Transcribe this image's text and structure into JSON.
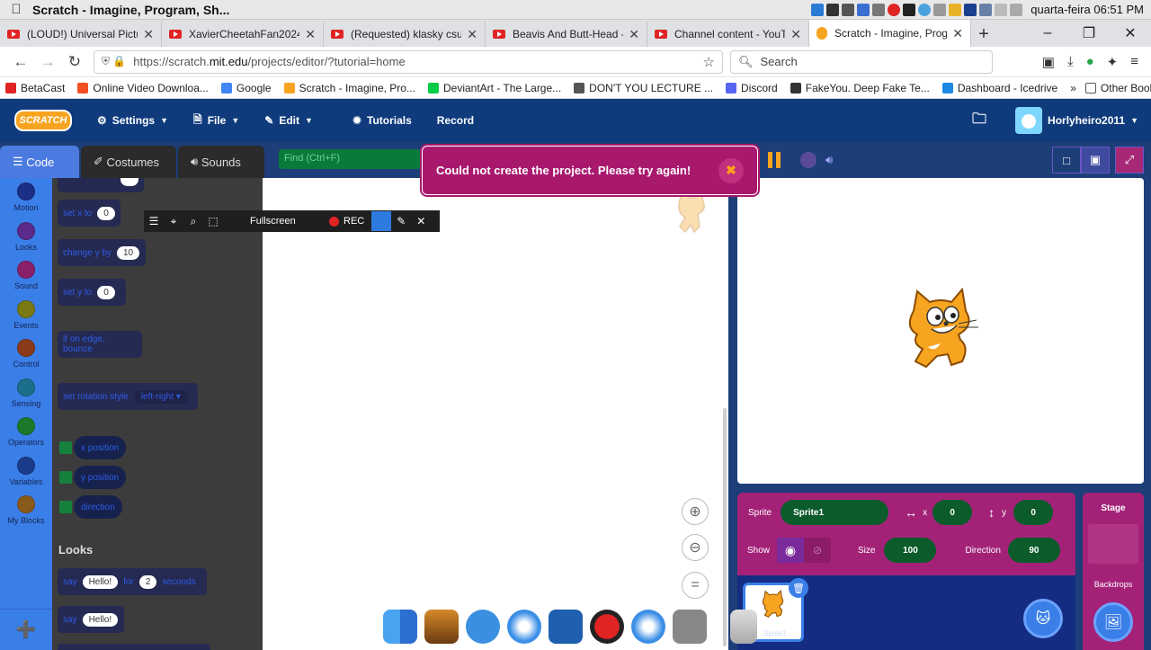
{
  "os": {
    "window_title": "Scratch - Imagine, Program, Sh...",
    "clock": "quarta-feira 06:51 PM"
  },
  "tabs": [
    {
      "label": "(LOUD!) Universal Picture",
      "icon": "youtube-icon"
    },
    {
      "label": "XavierCheetahFan2024 (F",
      "icon": "youtube-icon"
    },
    {
      "label": "(Requested) klasky csupo",
      "icon": "youtube-icon"
    },
    {
      "label": "Beavis And Butt-Head - P",
      "icon": "youtube-icon"
    },
    {
      "label": "Channel content - YouTu",
      "icon": "youtube-icon"
    },
    {
      "label": "Scratch - Imagine, Progra",
      "icon": "scratch-icon",
      "active": true
    }
  ],
  "browser": {
    "url_prefix": "https://scratch.",
    "url_host": "mit.edu",
    "url_rest": "/projects/editor/?tutorial=home",
    "search_placeholder": "Search"
  },
  "bookmarks": [
    {
      "label": "BetaCast",
      "color": "#e02424"
    },
    {
      "label": "Online Video Downloa...",
      "color": "#f25022"
    },
    {
      "label": "Google",
      "color": "#4285f4"
    },
    {
      "label": "Scratch - Imagine, Pro...",
      "color": "#f7a521"
    },
    {
      "label": "DeviantArt - The Large...",
      "color": "#05cc47"
    },
    {
      "label": "DON'T YOU LECTURE ...",
      "color": "#555555"
    },
    {
      "label": "Discord",
      "color": "#5865f2"
    },
    {
      "label": "FakeYou. Deep Fake Te...",
      "color": "#333333"
    },
    {
      "label": "Dashboard - Icedrive",
      "color": "#1e88e5"
    }
  ],
  "bookmarks_other": "Other Bookmarks",
  "scratch_menu": {
    "logo": "SCRATCH",
    "settings": "Settings",
    "file": "File",
    "edit": "Edit",
    "tutorials": "Tutorials",
    "record": "Record",
    "username": "Horlyheiro2011"
  },
  "editor_tabs": {
    "code": "Code",
    "costumes": "Costumes",
    "sounds": "Sounds"
  },
  "find_placeholder": "Find (Ctrl+F)",
  "categories": [
    {
      "label": "Motion",
      "color": "#1c2f86"
    },
    {
      "label": "Looks",
      "color": "#5b2a8a"
    },
    {
      "label": "Sound",
      "color": "#8a1f6a"
    },
    {
      "label": "Events",
      "color": "#7a7a12"
    },
    {
      "label": "Control",
      "color": "#8a3a1a"
    },
    {
      "label": "Sensing",
      "color": "#1a6f8a"
    },
    {
      "label": "Operators",
      "color": "#1a7a2a"
    },
    {
      "label": "Variables",
      "color": "#1a3c8a"
    },
    {
      "label": "My Blocks",
      "color": "#8a5a1a"
    }
  ],
  "blocks": {
    "set_x": {
      "label": "set x to",
      "value": "0"
    },
    "change_y": {
      "label": "change y by",
      "value": "10"
    },
    "set_y": {
      "label": "set y to",
      "value": "0"
    },
    "bounce": "if on edge, bounce",
    "rotation": {
      "label": "set rotation style",
      "option": "left-right"
    },
    "x_position": "x position",
    "y_position": "y position",
    "direction": "direction",
    "looks_header": "Looks",
    "say_for": {
      "say": "say",
      "text": "Hello!",
      "for": "for",
      "secs": "2",
      "seconds": "seconds"
    },
    "say": {
      "say": "say",
      "text": "Hello!"
    }
  },
  "recorder": {
    "fullscreen": "Fullscreen",
    "rec": "REC"
  },
  "alert": {
    "message": "Could not create the project. Please try again!"
  },
  "sprite_info": {
    "sprite_label": "Sprite",
    "sprite_name": "Sprite1",
    "x_label": "x",
    "x": "0",
    "y_label": "y",
    "y": "0",
    "show_label": "Show",
    "size_label": "Size",
    "size": "100",
    "direction_label": "Direction",
    "direction": "90",
    "thumb_label": "Sprite1"
  },
  "stage_panel": {
    "title": "Stage",
    "backdrops": "Backdrops"
  }
}
